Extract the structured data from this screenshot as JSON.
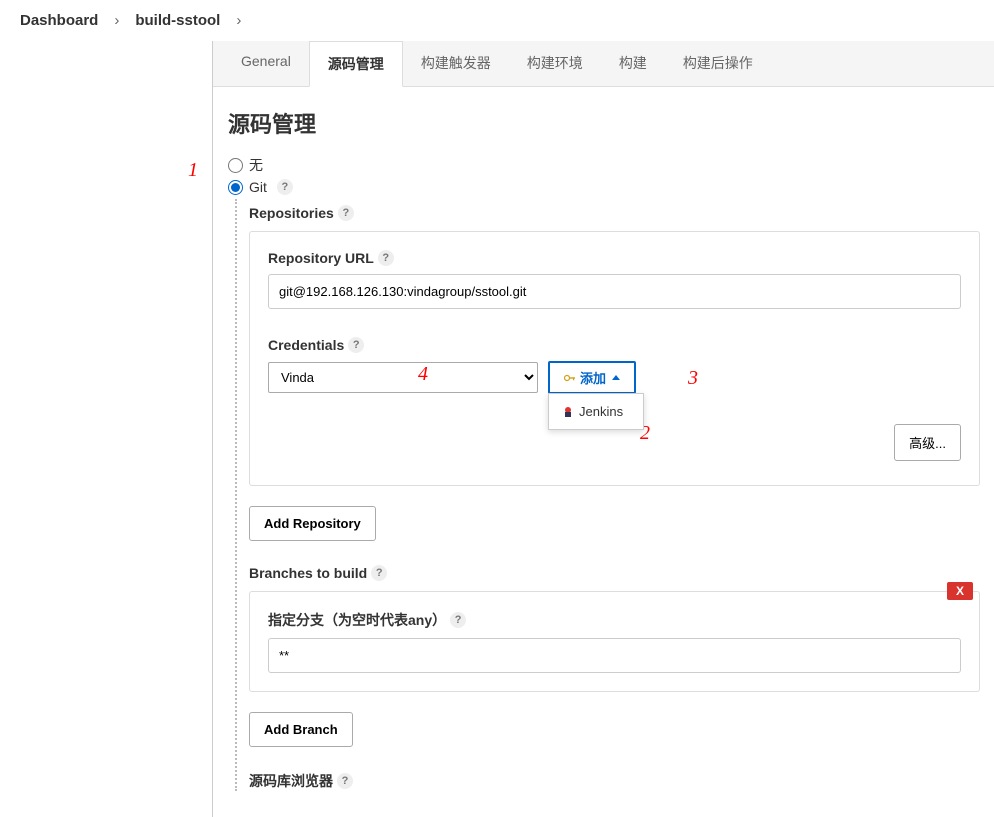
{
  "breadcrumb": {
    "root": "Dashboard",
    "item": "build-sstool"
  },
  "tabs": {
    "general": "General",
    "scm": "源码管理",
    "triggers": "构建触发器",
    "env": "构建环境",
    "build": "构建",
    "post": "构建后操作"
  },
  "section": {
    "title": "源码管理",
    "radio_none": "无",
    "radio_git": "Git",
    "repositories_label": "Repositories",
    "repo_url_label": "Repository URL",
    "repo_url_value": "git@192.168.126.130:vindagroup/sstool.git",
    "credentials_label": "Credentials",
    "credentials_value": "Vinda",
    "add_btn": "添加",
    "dropdown_item": "Jenkins",
    "advanced_btn": "高级...",
    "add_repo_btn": "Add Repository",
    "branches_label": "Branches to build",
    "branch_spec_label": "指定分支（为空时代表any）",
    "branch_value": "**",
    "add_branch_btn": "Add Branch",
    "delete_x": "X",
    "repo_browser_label": "源码库浏览器"
  },
  "annotations": {
    "a1": "1",
    "a2": "2",
    "a3": "3",
    "a4": "4"
  }
}
